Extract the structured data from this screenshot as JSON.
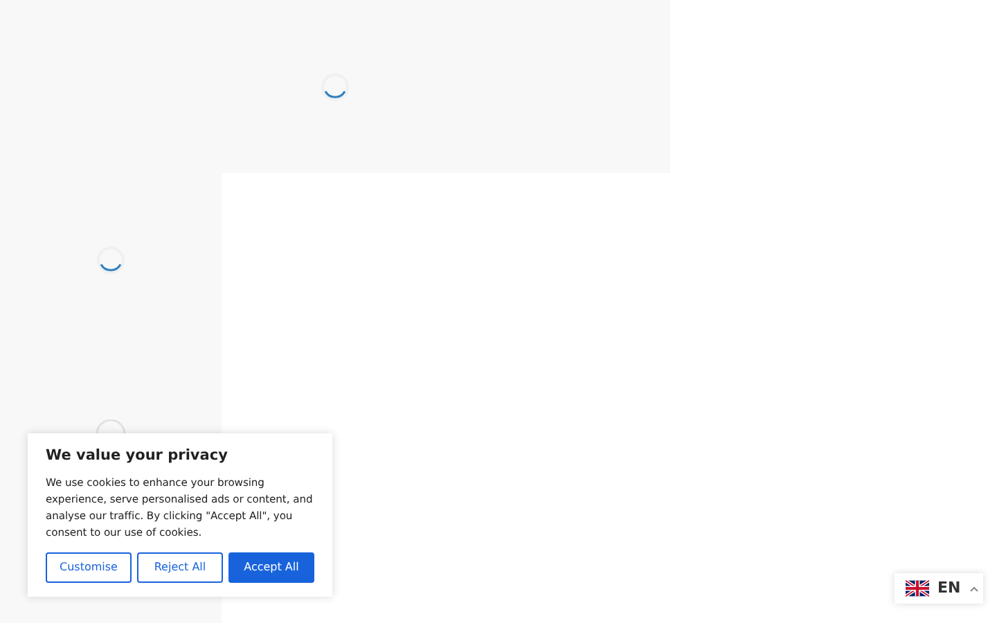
{
  "cookie_banner": {
    "title": "We value your privacy",
    "text": "We use cookies to enhance your browsing experience, serve personalised ads or content, and analyse our traffic. By clicking \"Accept All\", you consent to our use of cookies.",
    "buttons": [
      {
        "label": "Customise",
        "kind": "outline"
      },
      {
        "label": "Reject All",
        "kind": "outline"
      },
      {
        "label": "Accept All",
        "kind": "primary"
      }
    ]
  },
  "language_switcher": {
    "code": "EN"
  }
}
